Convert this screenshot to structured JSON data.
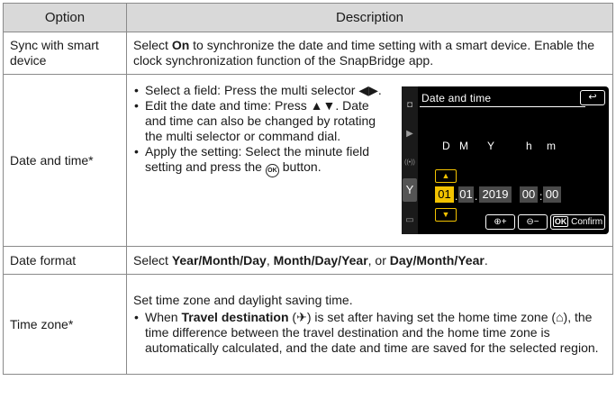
{
  "table": {
    "headers": {
      "option": "Option",
      "description": "Description"
    },
    "sync": {
      "option": "Sync with smart device",
      "d1a": "Select ",
      "d1b": "On",
      "d1c": " to synchronize the date and time setting with a smart device. Enable the clock synchronization function of the SnapBridge app."
    },
    "date_time": {
      "option": "Date and time*",
      "b1": "Select a field: Press the multi selector ◀▶.",
      "b2": "Edit the date and time: Press ▲▼. Date and time can also be changed by rotating the multi selector or command dial.",
      "b3a": "Apply the setting: Select the minute field setting and press the ",
      "b3icon": "OK",
      "b3b": " button."
    },
    "date_format": {
      "option": "Date format",
      "a": "Select ",
      "b": "Year/Month/Day",
      "c": ", ",
      "d": "Month/Day/Year",
      "e": ", or ",
      "f": "Day/Month/Year",
      "g": "."
    },
    "time_zone": {
      "option": "Time zone*",
      "intro": "Set time zone and daylight saving time.",
      "a": "When ",
      "b": "Travel destination",
      "c": " (",
      "travel_icon": "✈",
      "d": ") is set after having set the home time zone (",
      "home_icon": "⌂",
      "e": "), the time difference between the travel destination and the home time zone is automatically calculated, and the date and time are saved for the selected region."
    }
  },
  "camera_screen": {
    "title": "Date and time",
    "back_icon": "↩",
    "labels": {
      "d": "D",
      "m": "M",
      "y": "Y",
      "h": "h",
      "min": "m"
    },
    "values": {
      "day": "01",
      "month": "01",
      "year": "2019",
      "hour": "00",
      "minute": "00"
    },
    "side_icons": {
      "camera": "◘",
      "movie": "▶",
      "network": "((•))",
      "setup": "Y",
      "battery": "▭"
    },
    "up_arrow": "▲",
    "down_arrow": "▼",
    "buttons": {
      "plus": "⊕+",
      "minus": "⊖−",
      "ok": "OK",
      "confirm": "Confirm"
    }
  }
}
